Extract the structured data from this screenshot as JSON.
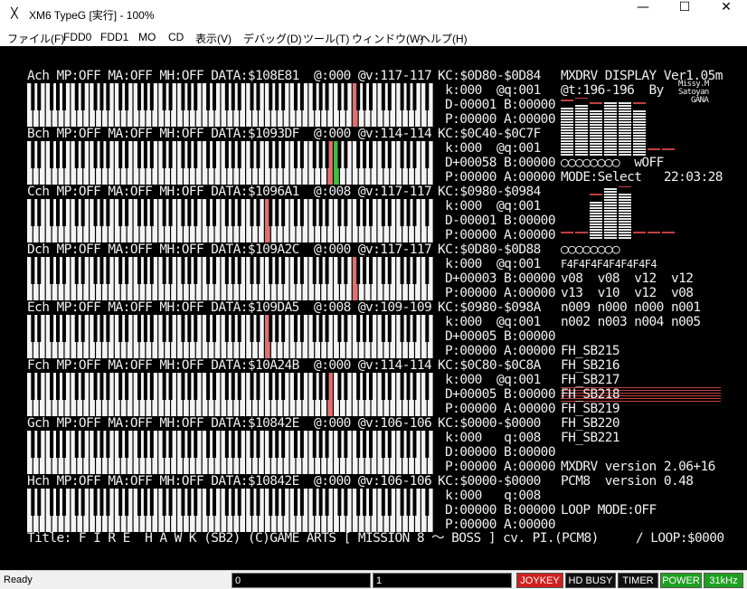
{
  "window": {
    "title": "XM6 TypeG [実行] - 100%",
    "icon": "xm6-app-icon",
    "min_glyph": "—",
    "max_glyph": "☐",
    "close_glyph": "✕"
  },
  "menu": [
    "ファイル(F)",
    "FDD0",
    "FDD1",
    "MO",
    "CD",
    "表示(V)",
    "デバッグ(D)",
    "ツール(T)",
    "ウィンドウ(W)",
    "ヘルプ(H)"
  ],
  "channels": [
    {
      "header": "Ach MP:OFF MA:OFF MH:OFF DATA:$108E81  @:000 @v:117-117",
      "kc": "KC:$0D80-$0D84",
      "kq": " k:000  @q:001",
      "d": "D-00001 B:00000",
      "p": "P:00000 A:00000",
      "keys_red": [
        52
      ],
      "keys_green": []
    },
    {
      "header": "Bch MP:OFF MA:OFF MH:OFF DATA:$1093DF  @:000 @v:114-114",
      "kc": "KC:$0C40-$0C7F",
      "kq": " k:000  @q:001",
      "d": "D+00058 B:00000",
      "p": "P:00000 A:00000",
      "keys_red": [
        48
      ],
      "keys_green": [
        49
      ]
    },
    {
      "header": "Cch MP:OFF MA:OFF MH:OFF DATA:$1096A1  @:008 @v:117-117",
      "kc": "KC:$0980-$0984",
      "kq": " k:000  @q:001",
      "d": "D-00001 B:00000",
      "p": "P:00000 A:00000",
      "keys_red": [
        38
      ],
      "keys_green": []
    },
    {
      "header": "Dch MP:OFF MA:OFF MH:OFF DATA:$109A2C  @:000 @v:117-117",
      "kc": "KC:$0D80-$0D88",
      "kq": " k:000  @q:001",
      "d": "D+00003 B:00000",
      "p": "P:00000 A:00000",
      "keys_red": [
        52
      ],
      "keys_green": []
    },
    {
      "header": "Ech MP:OFF MA:OFF MH:OFF DATA:$109DA5  @:008 @v:109-109",
      "kc": "KC:$0980-$098A",
      "kq": " k:000  @q:001",
      "d": "D+00005 B:00000",
      "p": "P:00000 A:00000",
      "keys_red": [
        38
      ],
      "keys_green": []
    },
    {
      "header": "Fch MP:OFF MA:OFF MH:OFF DATA:$10A24B  @:000 @v:114-114",
      "kc": "KC:$0C80-$0C8A",
      "kq": " k:000  @q:001",
      "d": "D+00005 B:00000",
      "p": "P:00000 A:00000",
      "keys_red": [
        48
      ],
      "keys_green": []
    },
    {
      "header": "Gch MP:OFF MA:OFF MH:OFF DATA:$10842E  @:000 @v:106-106",
      "kc": "KC:$0000-$0000",
      "kq": " k:000   q:008",
      "d": "D:00000 B:00000",
      "p": "P:00000 A:00000",
      "keys_red": [],
      "keys_green": []
    },
    {
      "header": "Hch MP:OFF MA:OFF MH:OFF DATA:$10842E  @:000 @v:106-106",
      "kc": "KC:$0000-$0000",
      "kq": " k:000   q:008",
      "d": "D:00000 B:00000",
      "p": "P:00000 A:00000",
      "keys_red": [],
      "keys_green": []
    }
  ],
  "right": {
    "display_title": "MXDRV DISPLAY Ver1.05m",
    "tempo": "@t:196-196  By",
    "author1": "Missy.M",
    "author2": "Satoyan",
    "author3": "GANA",
    "circles1": "○○○○○○○○  wOFF",
    "mode": "MODE:Select   22:03:28",
    "circles2": "○○○○○○○○",
    "f4row": "F4F4F4F4F4F4F4F4",
    "vol1": "v08  v08  v12  v12",
    "vol2": "v13  v10  v12  v08",
    "n1": "n009 n000 n000 n001",
    "n2": "n002 n003 n004 n005",
    "files": [
      "FH_SB215",
      "FH_SB216",
      "FH_SB217",
      "FH_SB218",
      "FH_SB219",
      "FH_SB220",
      "FH_SB221"
    ],
    "selected_file_index": 3,
    "version1": "MXDRV version 2.06+16",
    "version2": "PCM8  version 0.48",
    "loop_mode": "LOOP MODE:OFF"
  },
  "footer": {
    "title_line": "Title: F I R E  H A W K (SB2) (C)GAME ARTS [ MISSION 8 ～ BOSS ] cv. PI.(PCM8)",
    "loop": "/ LOOP:$0000"
  },
  "status": {
    "text": "Ready",
    "box1": "0",
    "box2": "1",
    "joykey": "JOYKEY",
    "hdbusy": "HD BUSY",
    "timer": "TIMER",
    "power": "POWER",
    "clock": "31kHz"
  },
  "colors": {
    "key_red": "#e07070",
    "key_green": "#40c040",
    "joykey_bg": "#d02020",
    "power_bg": "#20a020",
    "clock_bg": "#20a020",
    "hdbusy_bg": "#101010",
    "timer_bg": "#101010",
    "highlight": "#c04040"
  }
}
